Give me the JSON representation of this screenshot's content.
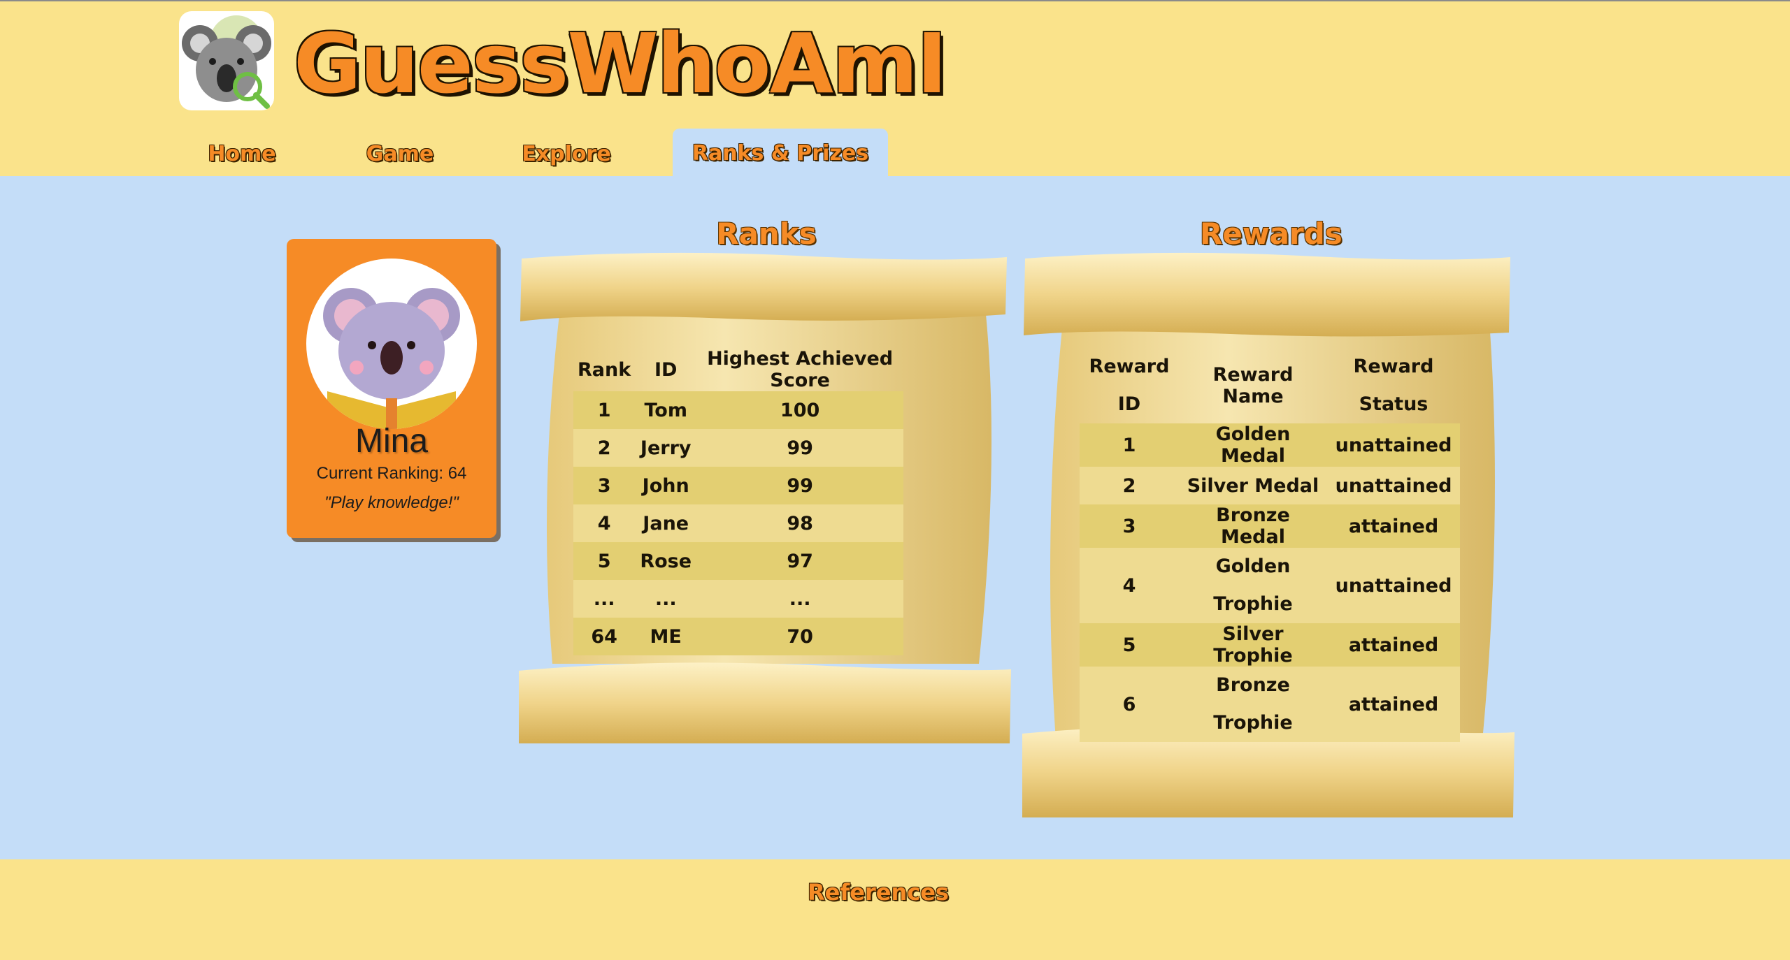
{
  "brand": {
    "title": "GuessWhoAmI",
    "logo_icon": "koala-magnifier-logo"
  },
  "nav": {
    "items": [
      {
        "label": "Home"
      },
      {
        "label": "Game"
      },
      {
        "label": "Explore"
      },
      {
        "label": "Ranks & Prizes",
        "active": true
      }
    ]
  },
  "profile": {
    "avatar_icon": "koala-reading-avatar",
    "name": "Mina",
    "ranking": "Current Ranking: 64",
    "motto": "\"Play knowledge!\""
  },
  "ranks": {
    "title": "Ranks",
    "headers": [
      "Rank",
      "ID",
      "Highest Achieved Score"
    ],
    "rows": [
      [
        "1",
        "Tom",
        "100"
      ],
      [
        "2",
        "Jerry",
        "99"
      ],
      [
        "3",
        "John",
        "99"
      ],
      [
        "4",
        "Jane",
        "98"
      ],
      [
        "5",
        "Rose",
        "97"
      ],
      [
        "...",
        "...",
        "..."
      ],
      [
        "64",
        "ME",
        "70"
      ]
    ]
  },
  "rewards": {
    "title": "Rewards",
    "headers": [
      "Reward ID",
      "Reward Name",
      "Reward Status"
    ],
    "rows": [
      [
        "1",
        "Golden Medal",
        "unattained"
      ],
      [
        "2",
        "Silver Medal",
        "unattained"
      ],
      [
        "3",
        "Bronze Medal",
        "attained"
      ],
      [
        "4",
        "Golden Trophie",
        "unattained"
      ],
      [
        "5",
        "Silver Trophie",
        "attained"
      ],
      [
        "6",
        "Bronze Trophie",
        "attained"
      ]
    ]
  },
  "footer": {
    "link": "References"
  },
  "colors": {
    "header_bg": "#fae38b",
    "main_bg": "#c4ddf8",
    "accent": "#f68b26",
    "parchment": "#efd98e"
  }
}
